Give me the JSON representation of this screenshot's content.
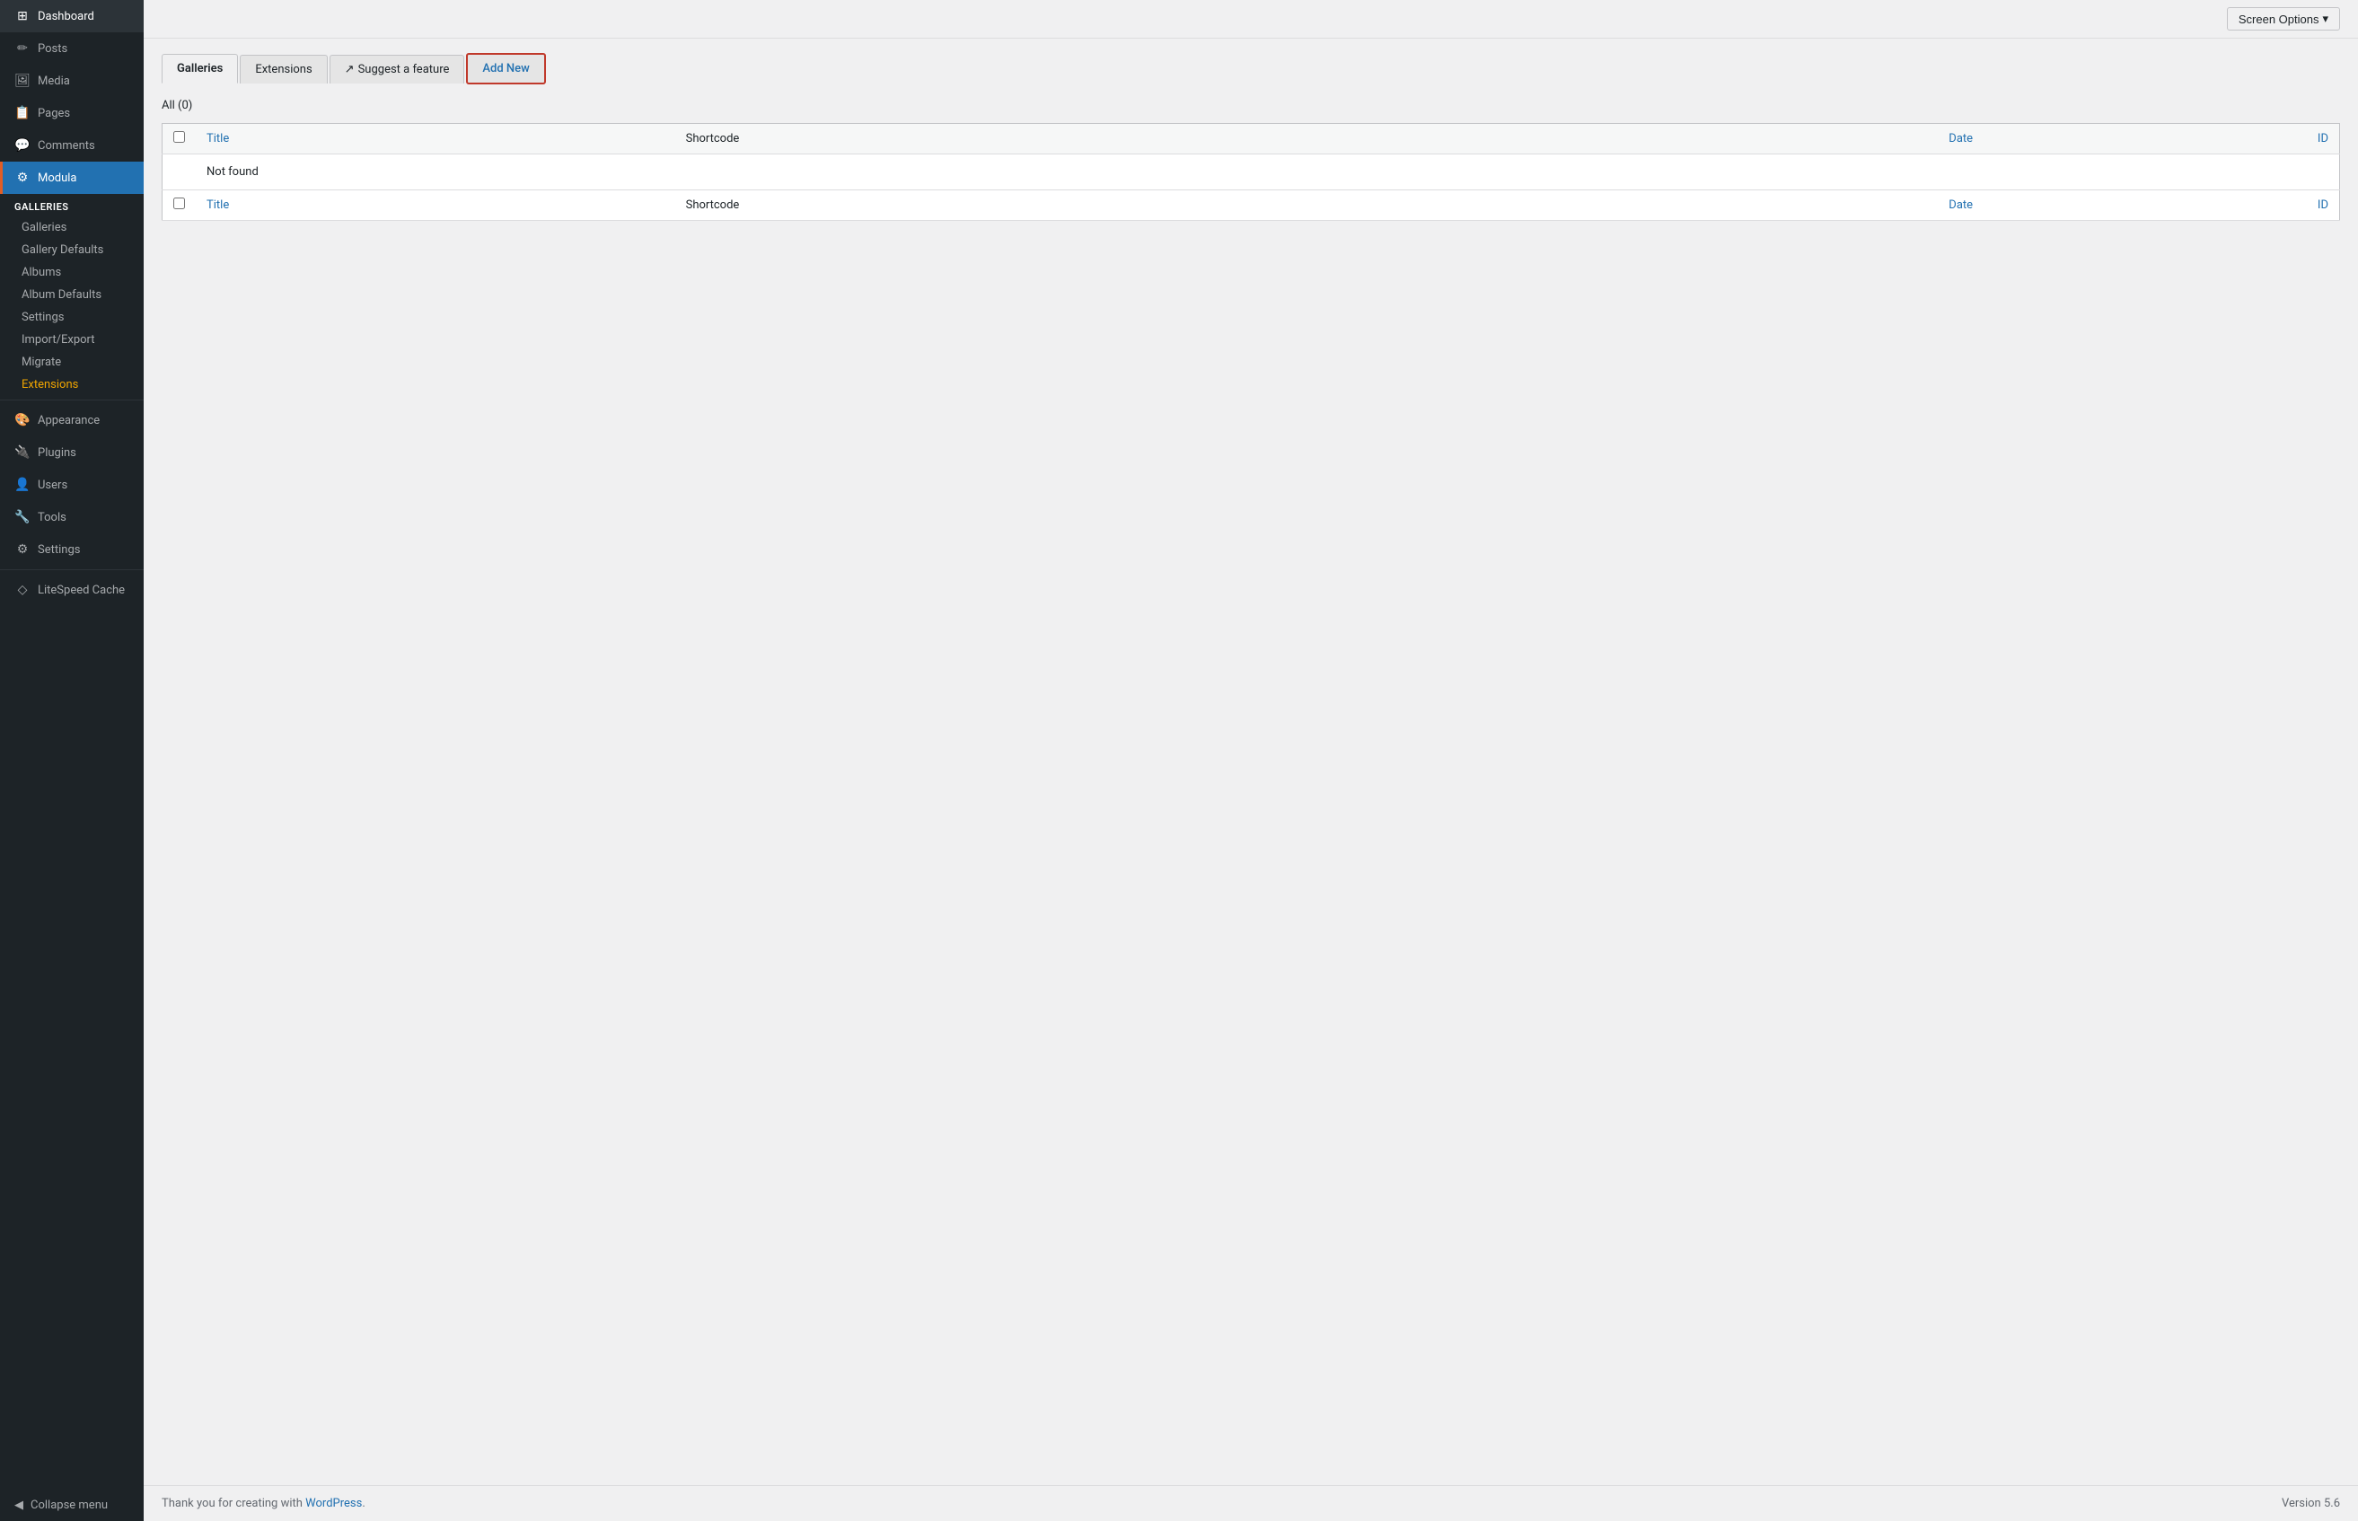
{
  "sidebar": {
    "items": [
      {
        "id": "dashboard",
        "label": "Dashboard",
        "icon": "⊞"
      },
      {
        "id": "posts",
        "label": "Posts",
        "icon": "📄"
      },
      {
        "id": "media",
        "label": "Media",
        "icon": "🖼"
      },
      {
        "id": "pages",
        "label": "Pages",
        "icon": "📋"
      },
      {
        "id": "comments",
        "label": "Comments",
        "icon": "💬"
      },
      {
        "id": "modula",
        "label": "Modula",
        "icon": "⚙"
      }
    ],
    "modula_section": {
      "title": "Galleries",
      "subitems": [
        {
          "id": "galleries",
          "label": "Galleries",
          "active": false
        },
        {
          "id": "gallery-defaults",
          "label": "Gallery Defaults",
          "active": false
        },
        {
          "id": "albums",
          "label": "Albums",
          "active": false
        },
        {
          "id": "album-defaults",
          "label": "Album Defaults",
          "active": false
        },
        {
          "id": "settings",
          "label": "Settings",
          "active": false
        },
        {
          "id": "import-export",
          "label": "Import/Export",
          "active": false
        },
        {
          "id": "migrate",
          "label": "Migrate",
          "active": false
        },
        {
          "id": "extensions",
          "label": "Extensions",
          "active": true,
          "color": "orange"
        }
      ]
    },
    "lower_items": [
      {
        "id": "appearance",
        "label": "Appearance",
        "icon": "🎨"
      },
      {
        "id": "plugins",
        "label": "Plugins",
        "icon": "🔌"
      },
      {
        "id": "users",
        "label": "Users",
        "icon": "👤"
      },
      {
        "id": "tools",
        "label": "Tools",
        "icon": "🔧"
      },
      {
        "id": "settings",
        "label": "Settings",
        "icon": "⚙"
      },
      {
        "id": "litespeed-cache",
        "label": "LiteSpeed Cache",
        "icon": "◇"
      }
    ],
    "collapse_label": "Collapse menu"
  },
  "topbar": {
    "screen_options_label": "Screen Options",
    "screen_options_arrow": "▾"
  },
  "tabs": [
    {
      "id": "galleries",
      "label": "Galleries",
      "current": true
    },
    {
      "id": "extensions",
      "label": "Extensions",
      "current": false
    },
    {
      "id": "suggest-feature",
      "label": "Suggest a feature",
      "external": true,
      "icon": "↗"
    },
    {
      "id": "add-new",
      "label": "Add New",
      "highlighted": true
    }
  ],
  "content": {
    "all_label": "All",
    "all_count": "(0)",
    "table": {
      "columns": [
        {
          "id": "title",
          "label": "Title",
          "type": "link"
        },
        {
          "id": "shortcode",
          "label": "Shortcode",
          "type": "text"
        },
        {
          "id": "date",
          "label": "Date",
          "type": "link"
        },
        {
          "id": "id",
          "label": "ID",
          "type": "link"
        }
      ],
      "not_found": "Not found",
      "rows": []
    }
  },
  "footer": {
    "thank_you_text": "Thank you for creating with",
    "wordpress_link": "WordPress",
    "version_label": "Version 5.6"
  }
}
